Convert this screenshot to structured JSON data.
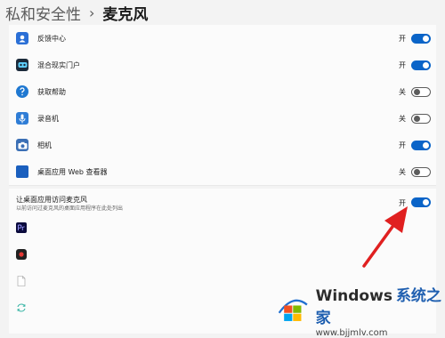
{
  "breadcrumb": {
    "parent": "私和安全性",
    "separator": "›",
    "current": "麦克风"
  },
  "apps": [
    {
      "name": "反馈中心",
      "state": "开",
      "on": true,
      "icon": "feedback-hub-icon"
    },
    {
      "name": "混合现实门户",
      "state": "开",
      "on": true,
      "icon": "mixed-reality-icon"
    },
    {
      "name": "获取帮助",
      "state": "关",
      "on": false,
      "icon": "get-help-icon"
    },
    {
      "name": "录音机",
      "state": "关",
      "on": false,
      "icon": "voice-recorder-icon"
    },
    {
      "name": "相机",
      "state": "开",
      "on": true,
      "icon": "camera-icon"
    },
    {
      "name": "桌面应用 Web 查看器",
      "state": "关",
      "on": false,
      "icon": "web-viewer-icon"
    }
  ],
  "desktop_apps": {
    "title": "让桌面应用访问麦克风",
    "subtitle": "以前访问过麦克风的桌面应用程序在此处列出",
    "state": "开",
    "on": true,
    "icons": [
      "premiere-pro-icon",
      "recorder-app-icon",
      "file-icon",
      "sync-app-icon"
    ]
  },
  "watermark": {
    "brand": "Windows",
    "brand_cn": "系统之家",
    "url": "www.bjjmlv.com"
  },
  "colors": {
    "toggle_on": "#0a64c8",
    "arrow": "#e02020",
    "accent_blue": "#1f5fb0"
  }
}
